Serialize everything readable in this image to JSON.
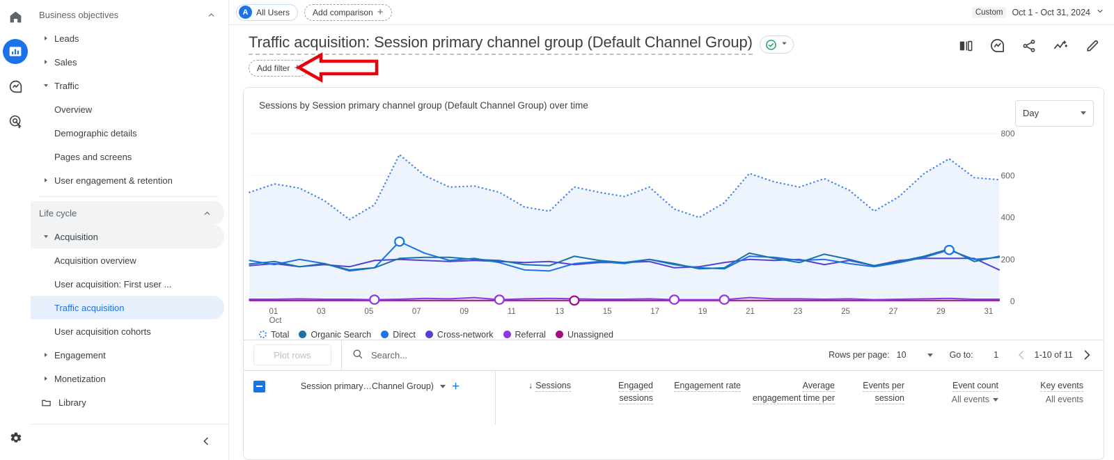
{
  "rail": {
    "items": [
      {
        "name": "home-icon",
        "label": "Home"
      },
      {
        "name": "reports-icon",
        "label": "Reports"
      },
      {
        "name": "explore-icon",
        "label": "Explore"
      },
      {
        "name": "advertising-icon",
        "label": "Advertising"
      }
    ],
    "gear_label": "Admin"
  },
  "sidebar": {
    "sections": [
      {
        "id": "business-objectives",
        "title": "Business objectives",
        "expanded": true,
        "items": [
          {
            "label": "Leads",
            "type": "group",
            "expanded": false
          },
          {
            "label": "Sales",
            "type": "group",
            "expanded": false
          },
          {
            "label": "Traffic",
            "type": "group",
            "expanded": true
          },
          {
            "label": "Overview",
            "type": "sub"
          },
          {
            "label": "Demographic details",
            "type": "sub"
          },
          {
            "label": "Pages and screens",
            "type": "sub"
          },
          {
            "label": "User engagement & retention",
            "type": "group",
            "expanded": false
          }
        ]
      },
      {
        "id": "life-cycle",
        "title": "Life cycle",
        "expanded": true,
        "items": [
          {
            "label": "Acquisition",
            "type": "group",
            "expanded": true,
            "highlighted": true
          },
          {
            "label": "Acquisition overview",
            "type": "sub"
          },
          {
            "label": "User acquisition: First user ...",
            "type": "sub"
          },
          {
            "label": "Traffic acquisition",
            "type": "sub",
            "selected": true
          },
          {
            "label": "User acquisition cohorts",
            "type": "sub"
          },
          {
            "label": "Engagement",
            "type": "group",
            "expanded": false
          },
          {
            "label": "Monetization",
            "type": "group",
            "expanded": false
          },
          {
            "label": "Library",
            "type": "folder"
          }
        ]
      }
    ],
    "collapse_label": "Collapse navigation"
  },
  "topbar": {
    "audience_chip": {
      "avatar": "A",
      "label": "All Users"
    },
    "add_comparison_label": "Add comparison",
    "date_tag": "Custom",
    "date_range": "Oct 1 - Oct 31, 2024"
  },
  "report": {
    "title": "Traffic acquisition: Session primary channel group (Default Channel Group)",
    "add_filter_label": "Add filter",
    "actions": [
      {
        "name": "compare-icon",
        "label": "Comparison"
      },
      {
        "name": "insights-icon",
        "label": "Insights"
      },
      {
        "name": "share-icon",
        "label": "Share this report"
      },
      {
        "name": "customize-chart-icon",
        "label": "Customize chart"
      },
      {
        "name": "edit-icon",
        "label": "Edit"
      }
    ]
  },
  "chart_card": {
    "title": "Sessions by Session primary channel group (Default Channel Group) over time",
    "granularity": "Day"
  },
  "chart_data": {
    "type": "line",
    "title": "Sessions by Session primary channel group (Default Channel Group) over time",
    "xlabel": "",
    "ylabel": "",
    "ylim": [
      0,
      800
    ],
    "yticks": [
      0,
      200,
      400,
      600,
      800
    ],
    "grid": true,
    "legend_position": "bottom",
    "x_axis_caption": "Oct",
    "x": [
      "01",
      "02",
      "03",
      "04",
      "05",
      "06",
      "07",
      "08",
      "09",
      "10",
      "11",
      "12",
      "13",
      "14",
      "15",
      "16",
      "17",
      "18",
      "19",
      "20",
      "21",
      "22",
      "23",
      "24",
      "25",
      "26",
      "27",
      "28",
      "29",
      "30",
      "31"
    ],
    "xticks": [
      "01",
      "03",
      "05",
      "07",
      "09",
      "11",
      "13",
      "15",
      "17",
      "19",
      "21",
      "23",
      "25",
      "27",
      "29",
      "31"
    ],
    "series": [
      {
        "name": "Total",
        "color": "#4285f4",
        "style": "dotted",
        "area": true,
        "values": [
          520,
          560,
          540,
          480,
          390,
          460,
          700,
          600,
          545,
          550,
          520,
          450,
          430,
          545,
          520,
          500,
          545,
          440,
          400,
          470,
          610,
          570,
          545,
          585,
          530,
          430,
          500,
          610,
          680,
          590,
          580
        ]
      },
      {
        "name": "Organic Search",
        "color": "#1a73a7",
        "style": "solid",
        "values": [
          178,
          190,
          165,
          180,
          150,
          160,
          205,
          210,
          210,
          200,
          195,
          175,
          170,
          215,
          195,
          185,
          200,
          180,
          155,
          160,
          230,
          205,
          185,
          225,
          200,
          170,
          190,
          215,
          250,
          190,
          215
        ]
      },
      {
        "name": "Direct",
        "color": "#1a73e8",
        "style": "solid",
        "marker_points": [
          {
            "x": "07",
            "y": 285
          },
          {
            "x": "29",
            "y": 245
          }
        ],
        "values": [
          195,
          175,
          200,
          180,
          145,
          160,
          285,
          230,
          195,
          205,
          185,
          150,
          145,
          180,
          190,
          180,
          200,
          175,
          160,
          155,
          215,
          210,
          195,
          200,
          180,
          165,
          185,
          210,
          245,
          200,
          210
        ]
      },
      {
        "name": "Cross-network",
        "color": "#5541d7",
        "style": "solid",
        "values": [
          170,
          180,
          165,
          175,
          165,
          195,
          200,
          195,
          190,
          195,
          190,
          185,
          190,
          175,
          185,
          185,
          190,
          160,
          165,
          185,
          200,
          195,
          200,
          175,
          195,
          170,
          195,
          205,
          205,
          205,
          150
        ]
      },
      {
        "name": "Referral",
        "color": "#9334e6",
        "style": "solid",
        "marker_points": [
          {
            "x": "06",
            "y": 8
          },
          {
            "x": "11",
            "y": 8
          },
          {
            "x": "18",
            "y": 8
          },
          {
            "x": "20",
            "y": 8
          }
        ],
        "values": [
          10,
          10,
          12,
          10,
          10,
          8,
          10,
          14,
          12,
          18,
          8,
          12,
          14,
          12,
          10,
          10,
          12,
          8,
          8,
          8,
          18,
          12,
          12,
          10,
          12,
          8,
          10,
          12,
          14,
          10,
          10
        ]
      },
      {
        "name": "Unassigned",
        "color": "#a50e82",
        "style": "solid",
        "marker_points": [
          {
            "x": "14",
            "y": 4
          }
        ],
        "values": [
          4,
          4,
          4,
          4,
          4,
          4,
          4,
          4,
          4,
          4,
          4,
          4,
          4,
          4,
          4,
          4,
          4,
          4,
          4,
          4,
          4,
          4,
          4,
          4,
          4,
          4,
          4,
          4,
          4,
          4,
          4
        ]
      }
    ]
  },
  "table": {
    "plot_rows_label": "Plot rows",
    "search_placeholder": "Search...",
    "rows_per_page_label": "Rows per page:",
    "rows_per_page_value": "10",
    "goto_label": "Go to:",
    "goto_value": "1",
    "range_label": "1-10 of 11",
    "dimension_header": "Session primary…Channel Group)",
    "columns": [
      {
        "label": "Sessions",
        "sorted": true,
        "sub": ""
      },
      {
        "label": "Engaged sessions",
        "sub": ""
      },
      {
        "label": "Engagement rate",
        "sub": ""
      },
      {
        "label": "Average engagement time per",
        "sub": ""
      },
      {
        "label": "Events per session",
        "sub": ""
      },
      {
        "label": "Event count",
        "sub": "All events"
      },
      {
        "label": "Key events",
        "sub": "All events"
      }
    ]
  },
  "colors": {
    "accent": "#1a73e8",
    "selected_bg": "#e8f0fe",
    "annotation_red": "#e8000d",
    "chart_area": "#e8f0fe"
  }
}
